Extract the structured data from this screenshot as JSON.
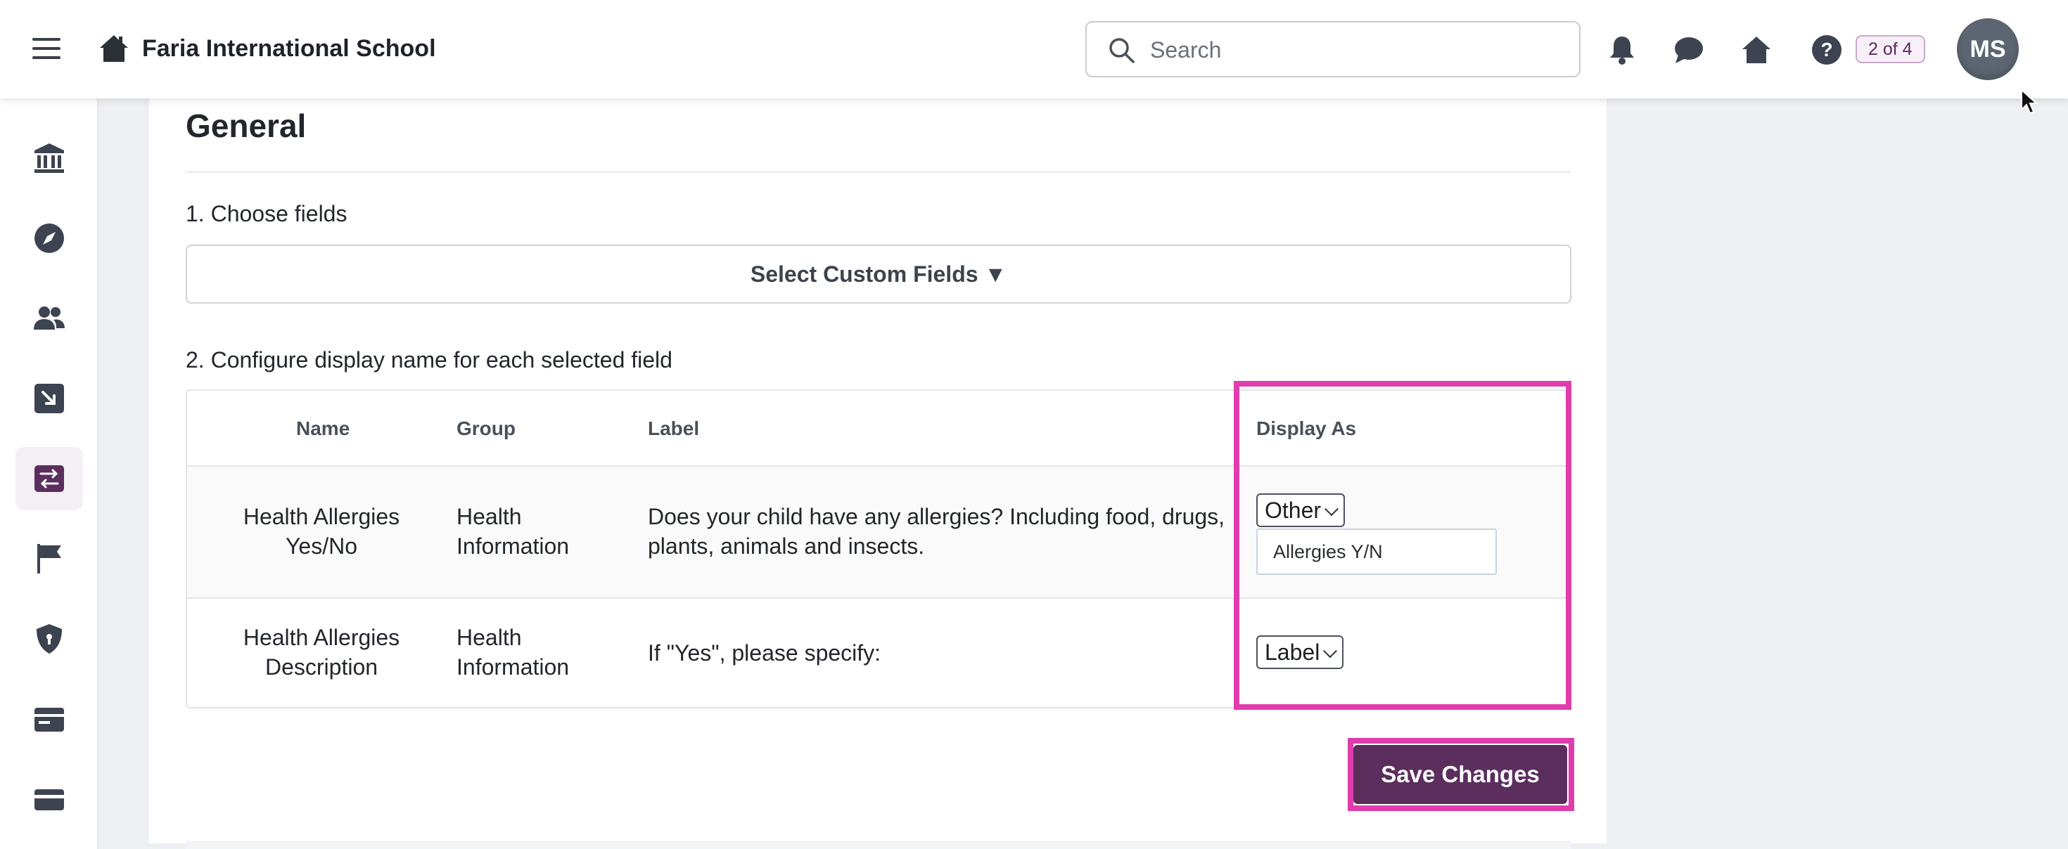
{
  "header": {
    "school_name": "Faria International School",
    "search_placeholder": "Search",
    "page_badge": "2 of 4",
    "avatar_initials": "MS"
  },
  "sidebar": {
    "items": [
      {
        "icon": "institution-icon"
      },
      {
        "icon": "compass-icon"
      },
      {
        "icon": "people-icon"
      },
      {
        "icon": "import-icon"
      },
      {
        "icon": "sync-icon",
        "active": true
      },
      {
        "icon": "flag-icon"
      },
      {
        "icon": "shield-icon"
      },
      {
        "icon": "calendar-card-icon"
      },
      {
        "icon": "card-icon"
      }
    ]
  },
  "main": {
    "section_title": "General",
    "step1_label": "1. Choose fields",
    "select_custom_fields": "Select Custom Fields ▼",
    "step2_label": "2. Configure display name for each selected field",
    "table": {
      "headers": [
        "Name",
        "Group",
        "Label",
        "Display As"
      ],
      "rows": [
        {
          "name": "Health Allergies Yes/No",
          "group": "Health Information",
          "label": "Does your child have any allergies? Including food, drugs, plants, animals and insects.",
          "display_as": "Other",
          "custom_value": "Allergies Y/N"
        },
        {
          "name": "Health Allergies Description",
          "group": "Health Information",
          "label": "If \"Yes\", please specify:",
          "display_as": "Label"
        }
      ]
    },
    "save_button": "Save Changes"
  },
  "colors": {
    "highlight": "#e03cab",
    "primary": "#5b2e5e",
    "badge_text": "#5c2a5f"
  }
}
